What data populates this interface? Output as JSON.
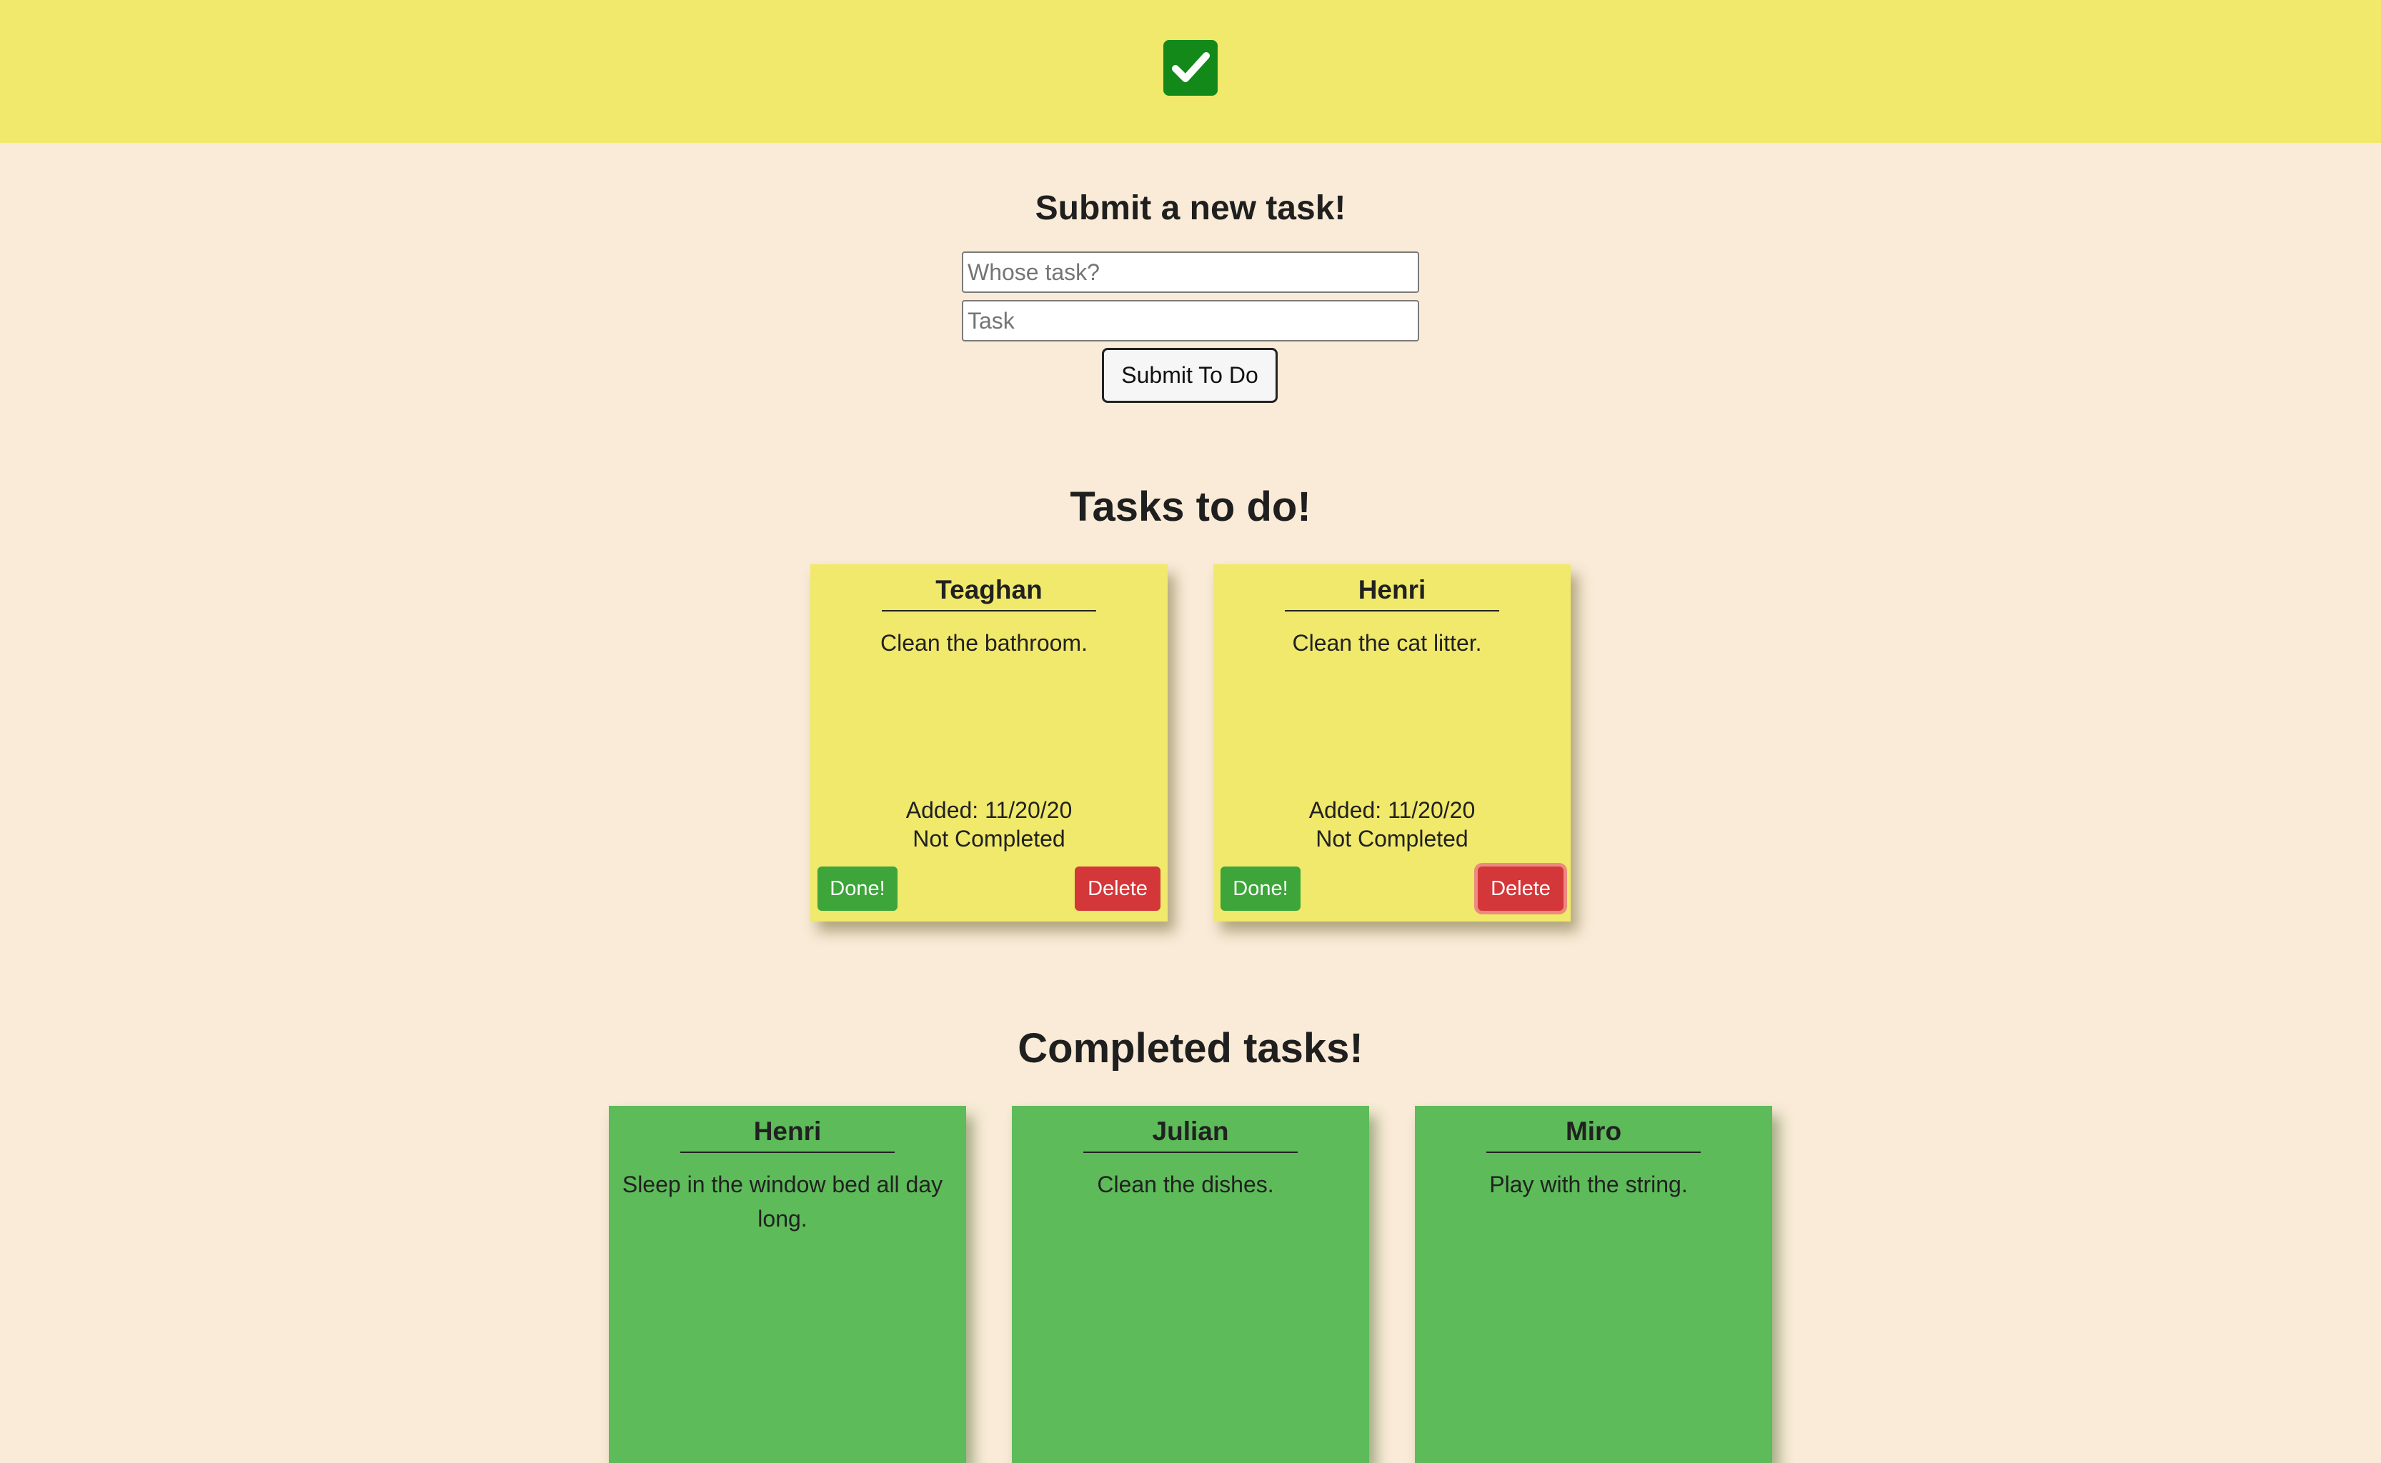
{
  "header": {
    "logo_icon": "checkbox-check-icon",
    "logo_color": "#13891a",
    "background": "#f0e96b"
  },
  "form": {
    "title": "Submit a new task!",
    "owner_placeholder": "Whose task?",
    "owner_value": "",
    "task_placeholder": "Task",
    "task_value": "",
    "submit_label": "Submit To Do"
  },
  "todo": {
    "title": "Tasks to do!",
    "cards": [
      {
        "owner": "Teaghan",
        "task": "Clean the bathroom.",
        "added": "Added: 11/20/20",
        "status": "Not Completed",
        "done_label": "Done!",
        "delete_label": "Delete"
      },
      {
        "owner": "Henri",
        "task": "Clean the cat litter.",
        "added": "Added: 11/20/20",
        "status": "Not Completed",
        "done_label": "Done!",
        "delete_label": "Delete"
      }
    ]
  },
  "completed": {
    "title": "Completed tasks!",
    "cards": [
      {
        "owner": "Henri",
        "task": "Sleep in the window bed all day long."
      },
      {
        "owner": "Julian",
        "task": "Clean the dishes."
      },
      {
        "owner": "Miro",
        "task": "Play with the string."
      }
    ]
  },
  "colors": {
    "page_background": "#f9ebd7",
    "todo_card": "#f0e96b",
    "completed_card": "#5dbb59",
    "done_button": "#3da53a",
    "delete_button": "#d3373a"
  }
}
